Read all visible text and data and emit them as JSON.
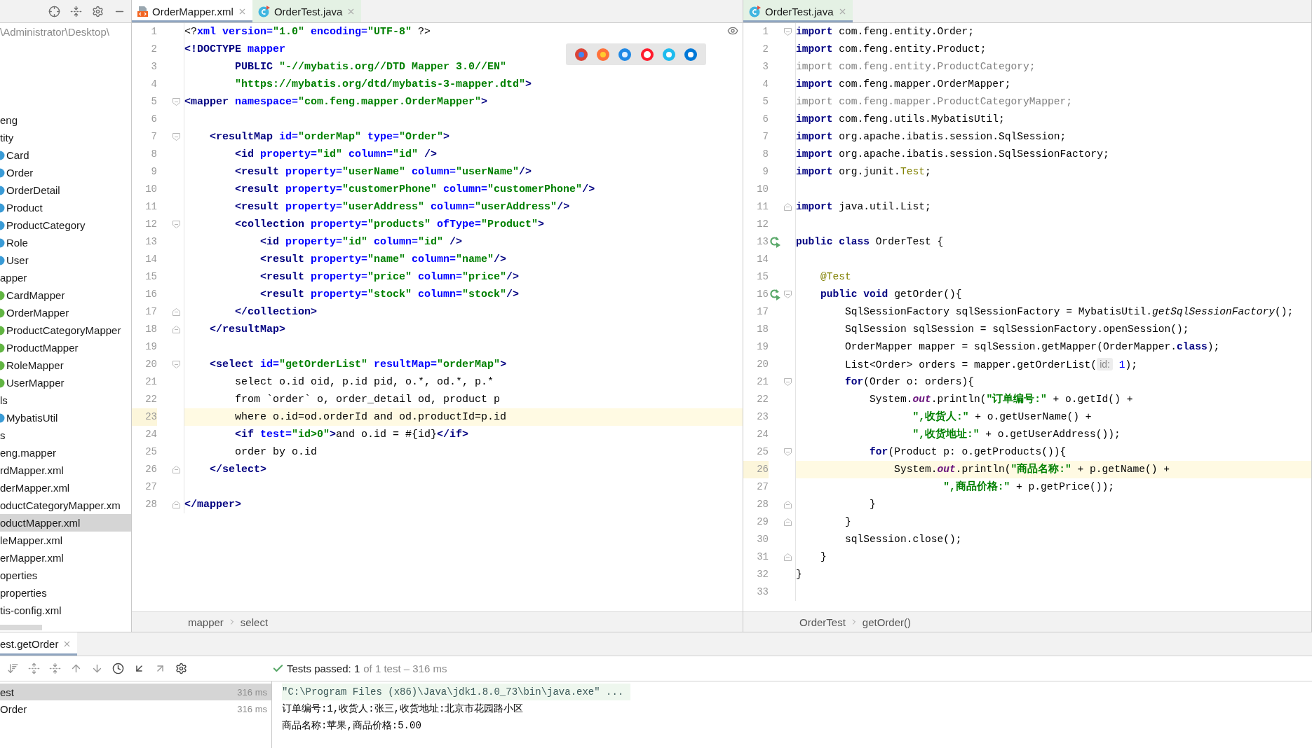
{
  "project_panel": {
    "path": "\\Administrator\\Desktop\\",
    "tree": [
      {
        "label": "eng",
        "selected": false,
        "children": [
          {
            "label": "tity",
            "selected": false,
            "children": [
              {
                "label": "Card",
                "kind": "class",
                "selected": false
              },
              {
                "label": "Order",
                "kind": "class",
                "selected": false
              },
              {
                "label": "OrderDetail",
                "kind": "class",
                "selected": false
              },
              {
                "label": "Product",
                "kind": "class",
                "selected": false
              },
              {
                "label": "ProductCategory",
                "kind": "class",
                "selected": false
              },
              {
                "label": "Role",
                "kind": "class",
                "selected": false
              },
              {
                "label": "User",
                "kind": "class",
                "selected": false
              }
            ]
          },
          {
            "label": "apper",
            "selected": false,
            "children": [
              {
                "label": "CardMapper",
                "kind": "interface",
                "selected": false
              },
              {
                "label": "OrderMapper",
                "kind": "interface",
                "selected": false
              },
              {
                "label": "ProductCategoryMapper",
                "kind": "interface",
                "selected": false
              },
              {
                "label": "ProductMapper",
                "kind": "interface",
                "selected": false
              },
              {
                "label": "RoleMapper",
                "kind": "interface",
                "selected": false
              },
              {
                "label": "UserMapper",
                "kind": "interface",
                "selected": false
              }
            ]
          },
          {
            "label": "ls",
            "selected": false,
            "children": [
              {
                "label": "MybatisUtil",
                "kind": "class",
                "selected": false
              }
            ]
          }
        ]
      },
      {
        "label": "s",
        "selected": false,
        "children": [
          {
            "label": "eng.mapper",
            "selected": false,
            "children": [
              {
                "label": "rdMapper.xml",
                "selected": false
              },
              {
                "label": "derMapper.xml",
                "selected": false
              },
              {
                "label": "oductCategoryMapper.xm",
                "selected": false
              },
              {
                "label": "oductMapper.xml",
                "selected": true
              },
              {
                "label": "leMapper.xml",
                "selected": false
              },
              {
                "label": "erMapper.xml",
                "selected": false
              }
            ]
          },
          {
            "label": "operties",
            "selected": false
          },
          {
            "label": "properties",
            "selected": false
          },
          {
            "label": "tis-config.xml",
            "selected": false
          }
        ]
      }
    ]
  },
  "editors": [
    {
      "tabs": [
        {
          "label": "OrderMapper.xml",
          "kind": "xml",
          "selected": true
        },
        {
          "label": "OrderTest.java",
          "kind": "test",
          "selected": false
        }
      ],
      "lines": [
        {
          "number": "1",
          "current": false,
          "tokens": [
            {
              "kind": "p",
              "text": "<?"
            },
            {
              "kind": "a",
              "text": "xml version="
            },
            {
              "kind": "s",
              "text": "\"1.0\""
            },
            {
              "kind": "a",
              "text": " encoding="
            },
            {
              "kind": "s",
              "text": "\"UTF-8\""
            },
            {
              "kind": "p",
              "text": " ?>"
            }
          ]
        },
        {
          "number": "2",
          "current": false,
          "tokens": [
            {
              "kind": "t",
              "text": "<!DOCTYPE "
            },
            {
              "kind": "a",
              "text": "mapper"
            }
          ]
        },
        {
          "number": "3",
          "current": false,
          "tokens": [
            {
              "kind": "t",
              "text": "        PUBLIC "
            },
            {
              "kind": "s",
              "text": "\"-//mybatis.org//DTD Mapper 3.0//EN\""
            }
          ]
        },
        {
          "number": "4",
          "current": false,
          "tokens": [
            {
              "kind": "s",
              "text": "        \"https://mybatis.org/dtd/mybatis-3-mapper.dtd\""
            },
            {
              "kind": "t",
              "text": ">"
            }
          ]
        },
        {
          "number": "5",
          "current": false,
          "kind": "fold",
          "tokens": [
            {
              "kind": "t",
              "text": "<mapper "
            },
            {
              "kind": "a",
              "text": "namespace="
            },
            {
              "kind": "s",
              "text": "\"com.feng.mapper.OrderMapper\""
            },
            {
              "kind": "t",
              "text": ">"
            }
          ]
        },
        {
          "number": "6",
          "current": false
        },
        {
          "number": "7",
          "current": false,
          "kind": "fold",
          "tokens": [
            {
              "kind": "t",
              "text": "    <resultMap "
            },
            {
              "kind": "a",
              "text": "id="
            },
            {
              "kind": "s",
              "text": "\"orderMap\""
            },
            {
              "kind": "a",
              "text": " type="
            },
            {
              "kind": "s",
              "text": "\"Order\""
            },
            {
              "kind": "t",
              "text": ">"
            }
          ]
        },
        {
          "number": "8",
          "current": false,
          "tokens": [
            {
              "kind": "t",
              "text": "        <id "
            },
            {
              "kind": "a",
              "text": "property="
            },
            {
              "kind": "s",
              "text": "\"id\""
            },
            {
              "kind": "a",
              "text": " column="
            },
            {
              "kind": "s",
              "text": "\"id\""
            },
            {
              "kind": "t",
              "text": " />"
            }
          ]
        },
        {
          "number": "9",
          "current": false,
          "tokens": [
            {
              "kind": "t",
              "text": "        <result "
            },
            {
              "kind": "a",
              "text": "property="
            },
            {
              "kind": "s",
              "text": "\"userName\""
            },
            {
              "kind": "a",
              "text": " column="
            },
            {
              "kind": "s",
              "text": "\"userName\""
            },
            {
              "kind": "t",
              "text": "/>"
            }
          ]
        },
        {
          "number": "10",
          "current": false,
          "tokens": [
            {
              "kind": "t",
              "text": "        <result "
            },
            {
              "kind": "a",
              "text": "property="
            },
            {
              "kind": "s",
              "text": "\"customerPhone\""
            },
            {
              "kind": "a",
              "text": " column="
            },
            {
              "kind": "s",
              "text": "\"customerPhone\""
            },
            {
              "kind": "t",
              "text": "/>"
            }
          ]
        },
        {
          "number": "11",
          "current": false,
          "tokens": [
            {
              "kind": "t",
              "text": "        <result "
            },
            {
              "kind": "a",
              "text": "property="
            },
            {
              "kind": "s",
              "text": "\"userAddress\""
            },
            {
              "kind": "a",
              "text": " column="
            },
            {
              "kind": "s",
              "text": "\"userAddress\""
            },
            {
              "kind": "t",
              "text": "/>"
            }
          ]
        },
        {
          "number": "12",
          "current": false,
          "kind": "fold",
          "tokens": [
            {
              "kind": "t",
              "text": "        <collection "
            },
            {
              "kind": "a",
              "text": "property="
            },
            {
              "kind": "s",
              "text": "\"products\""
            },
            {
              "kind": "a",
              "text": " ofType="
            },
            {
              "kind": "s",
              "text": "\"Product\""
            },
            {
              "kind": "t",
              "text": ">"
            }
          ]
        },
        {
          "number": "13",
          "current": false,
          "tokens": [
            {
              "kind": "t",
              "text": "            <id "
            },
            {
              "kind": "a",
              "text": "property="
            },
            {
              "kind": "s",
              "text": "\"id\""
            },
            {
              "kind": "a",
              "text": " column="
            },
            {
              "kind": "s",
              "text": "\"id\""
            },
            {
              "kind": "t",
              "text": " />"
            }
          ]
        },
        {
          "number": "14",
          "current": false,
          "tokens": [
            {
              "kind": "t",
              "text": "            <result "
            },
            {
              "kind": "a",
              "text": "property="
            },
            {
              "kind": "s",
              "text": "\"name\""
            },
            {
              "kind": "a",
              "text": " column="
            },
            {
              "kind": "s",
              "text": "\"name\""
            },
            {
              "kind": "t",
              "text": "/>"
            }
          ]
        },
        {
          "number": "15",
          "current": false,
          "tokens": [
            {
              "kind": "t",
              "text": "            <result "
            },
            {
              "kind": "a",
              "text": "property="
            },
            {
              "kind": "s",
              "text": "\"price\""
            },
            {
              "kind": "a",
              "text": " column="
            },
            {
              "kind": "s",
              "text": "\"price\""
            },
            {
              "kind": "t",
              "text": "/>"
            }
          ]
        },
        {
          "number": "16",
          "current": false,
          "tokens": [
            {
              "kind": "t",
              "text": "            <result "
            },
            {
              "kind": "a",
              "text": "property="
            },
            {
              "kind": "s",
              "text": "\"stock\""
            },
            {
              "kind": "a",
              "text": " column="
            },
            {
              "kind": "s",
              "text": "\"stock\""
            },
            {
              "kind": "t",
              "text": "/>"
            }
          ]
        },
        {
          "number": "17",
          "current": false,
          "kind": "end",
          "tokens": [
            {
              "kind": "t",
              "text": "        </collection>"
            }
          ]
        },
        {
          "number": "18",
          "current": false,
          "kind": "end",
          "tokens": [
            {
              "kind": "t",
              "text": "    </resultMap>"
            }
          ]
        },
        {
          "number": "19",
          "current": false
        },
        {
          "number": "20",
          "current": false,
          "kind": "fold",
          "tokens": [
            {
              "kind": "t",
              "text": "    <select "
            },
            {
              "kind": "a",
              "text": "id="
            },
            {
              "kind": "s",
              "text": "\"getOrderList\""
            },
            {
              "kind": "a",
              "text": " resultMap="
            },
            {
              "kind": "s",
              "text": "\"orderMap\""
            },
            {
              "kind": "t",
              "text": ">"
            }
          ]
        },
        {
          "number": "21",
          "current": false,
          "tokens": [
            {
              "kind": "p",
              "text": "        select o.id oid, p.id pid, o.*, od.*, p.*"
            }
          ]
        },
        {
          "number": "22",
          "current": false,
          "tokens": [
            {
              "kind": "p",
              "text": "        from `order` o, order_detail od, product p"
            }
          ]
        },
        {
          "number": "23",
          "current": true,
          "tokens": [
            {
              "kind": "p",
              "text": "        where o.id=od.orderId and od.productId=p.id"
            }
          ]
        },
        {
          "number": "24",
          "current": false,
          "tokens": [
            {
              "kind": "t",
              "text": "        <if "
            },
            {
              "kind": "a",
              "text": "test="
            },
            {
              "kind": "s",
              "text": "\"id>0\""
            },
            {
              "kind": "t",
              "text": ">"
            },
            {
              "kind": "p",
              "text": "and o.id = #{id}"
            },
            {
              "kind": "t",
              "text": "</if>"
            }
          ]
        },
        {
          "number": "25",
          "current": false,
          "tokens": [
            {
              "kind": "p",
              "text": "        order by o.id"
            }
          ]
        },
        {
          "number": "26",
          "current": false,
          "kind": "end",
          "tokens": [
            {
              "kind": "t",
              "text": "    </select>"
            }
          ]
        },
        {
          "number": "27",
          "current": false
        },
        {
          "number": "28",
          "current": false,
          "kind": "end",
          "tokens": [
            {
              "kind": "t",
              "text": "</mapper>"
            }
          ]
        }
      ],
      "breadcrumbs": [
        "mapper",
        "select"
      ]
    },
    {
      "tabs": [
        {
          "label": "OrderTest.java",
          "kind": "test",
          "selected": true
        }
      ],
      "lines": [
        {
          "number": "1",
          "current": false,
          "kind": "fold",
          "tokens": [
            {
              "kind": "k",
              "text": "import"
            },
            {
              "kind": "p",
              "text": " com.feng.entity.Order;"
            }
          ]
        },
        {
          "number": "2",
          "current": false,
          "tokens": [
            {
              "kind": "k",
              "text": "import"
            },
            {
              "kind": "p",
              "text": " com.feng.entity.Product;"
            }
          ]
        },
        {
          "number": "3",
          "current": false,
          "tokens": [
            {
              "kind": "d",
              "text": "import com.feng.entity.ProductCategory;"
            }
          ]
        },
        {
          "number": "4",
          "current": false,
          "tokens": [
            {
              "kind": "k",
              "text": "import"
            },
            {
              "kind": "p",
              "text": " com.feng.mapper.OrderMapper;"
            }
          ]
        },
        {
          "number": "5",
          "current": false,
          "tokens": [
            {
              "kind": "d",
              "text": "import com.feng.mapper.ProductCategoryMapper;"
            }
          ]
        },
        {
          "number": "6",
          "current": false,
          "tokens": [
            {
              "kind": "k",
              "text": "import"
            },
            {
              "kind": "p",
              "text": " com.feng.utils.MybatisUtil;"
            }
          ]
        },
        {
          "number": "7",
          "current": false,
          "tokens": [
            {
              "kind": "k",
              "text": "import"
            },
            {
              "kind": "p",
              "text": " org.apache.ibatis.session.SqlSession;"
            }
          ]
        },
        {
          "number": "8",
          "current": false,
          "tokens": [
            {
              "kind": "k",
              "text": "import"
            },
            {
              "kind": "p",
              "text": " org.apache.ibatis.session.SqlSessionFactory;"
            }
          ]
        },
        {
          "number": "9",
          "current": false,
          "tokens": [
            {
              "kind": "k",
              "text": "import"
            },
            {
              "kind": "p",
              "text": " org.junit."
            },
            {
              "kind": "n",
              "text": "Test"
            },
            {
              "kind": "p",
              "text": ";"
            }
          ]
        },
        {
          "number": "10",
          "current": false
        },
        {
          "number": "11",
          "current": false,
          "kind": "end",
          "tokens": [
            {
              "kind": "k",
              "text": "import"
            },
            {
              "kind": "p",
              "text": " java.util.List;"
            }
          ]
        },
        {
          "number": "12",
          "current": false
        },
        {
          "number": "13",
          "current": false,
          "kind": "run",
          "tokens": [
            {
              "kind": "k",
              "text": "public class"
            },
            {
              "kind": "p",
              "text": " OrderTest {"
            }
          ]
        },
        {
          "number": "14",
          "current": false
        },
        {
          "number": "15",
          "current": false,
          "tokens": [
            {
              "kind": "n",
              "text": "    @Test"
            }
          ]
        },
        {
          "number": "16",
          "current": false,
          "kind": "runfold",
          "tokens": [
            {
              "kind": "k",
              "text": "    public void"
            },
            {
              "kind": "p",
              "text": " getOrder(){"
            }
          ]
        },
        {
          "number": "17",
          "current": false,
          "tokens": [
            {
              "kind": "p",
              "text": "        SqlSessionFactory sqlSessionFactory = MybatisUtil."
            },
            {
              "kind": "m",
              "text": "getSqlSessionFactory"
            },
            {
              "kind": "p",
              "text": "();"
            }
          ]
        },
        {
          "number": "18",
          "current": false,
          "tokens": [
            {
              "kind": "p",
              "text": "        SqlSession sqlSession = sqlSessionFactory.openSession();"
            }
          ]
        },
        {
          "number": "19",
          "current": false,
          "tokens": [
            {
              "kind": "p",
              "text": "        OrderMapper mapper = sqlSession.getMapper(OrderMapper."
            },
            {
              "kind": "k",
              "text": "class"
            },
            {
              "kind": "p",
              "text": ");"
            }
          ]
        },
        {
          "number": "20",
          "current": false,
          "tokens": [
            {
              "kind": "p",
              "text": "        List<Order> orders = mapper.getOrderList("
            },
            {
              "kind": "h",
              "text": "id:"
            },
            {
              "kind": "u",
              "text": " 1"
            },
            {
              "kind": "p",
              "text": ");"
            }
          ]
        },
        {
          "number": "21",
          "current": false,
          "kind": "fold",
          "tokens": [
            {
              "kind": "k",
              "text": "        for"
            },
            {
              "kind": "p",
              "text": "(Order o: orders){"
            }
          ]
        },
        {
          "number": "22",
          "current": false,
          "tokens": [
            {
              "kind": "p",
              "text": "            System."
            },
            {
              "kind": "f",
              "text": "out"
            },
            {
              "kind": "p",
              "text": ".println("
            },
            {
              "kind": "s",
              "text": "\"订单编号:\""
            },
            {
              "kind": "p",
              "text": " + o.getId() +"
            }
          ]
        },
        {
          "number": "23",
          "current": false,
          "tokens": [
            {
              "kind": "s",
              "text": "                   \",收货人:\""
            },
            {
              "kind": "p",
              "text": " + o.getUserName() +"
            }
          ]
        },
        {
          "number": "24",
          "current": false,
          "tokens": [
            {
              "kind": "s",
              "text": "                   \",收货地址:\""
            },
            {
              "kind": "p",
              "text": " + o.getUserAddress());"
            }
          ]
        },
        {
          "number": "25",
          "current": false,
          "kind": "fold",
          "tokens": [
            {
              "kind": "k",
              "text": "            for"
            },
            {
              "kind": "p",
              "text": "(Product p: o.getProducts()){"
            }
          ]
        },
        {
          "number": "26",
          "current": true,
          "tokens": [
            {
              "kind": "p",
              "text": "                System."
            },
            {
              "kind": "f",
              "text": "out"
            },
            {
              "kind": "p",
              "text": ".println("
            },
            {
              "kind": "s",
              "text": "\"商品名称:\""
            },
            {
              "kind": "p",
              "text": " + p.getName() +"
            }
          ]
        },
        {
          "number": "27",
          "current": false,
          "tokens": [
            {
              "kind": "s",
              "text": "                        \",商品价格:\""
            },
            {
              "kind": "p",
              "text": " + p.getPrice());"
            }
          ]
        },
        {
          "number": "28",
          "current": false,
          "kind": "end",
          "tokens": [
            {
              "kind": "p",
              "text": "            }"
            }
          ]
        },
        {
          "number": "29",
          "current": false,
          "kind": "end",
          "tokens": [
            {
              "kind": "p",
              "text": "        }"
            }
          ]
        },
        {
          "number": "30",
          "current": false,
          "tokens": [
            {
              "kind": "p",
              "text": "        sqlSession.close();"
            }
          ]
        },
        {
          "number": "31",
          "current": false,
          "kind": "end",
          "tokens": [
            {
              "kind": "p",
              "text": "    }"
            }
          ]
        },
        {
          "number": "32",
          "current": false,
          "tokens": [
            {
              "kind": "p",
              "text": "}"
            }
          ]
        },
        {
          "number": "33",
          "current": false
        }
      ],
      "breadcrumbs": [
        "OrderTest",
        "getOrder()"
      ]
    }
  ],
  "run_panel": {
    "tab": "est.getOrder",
    "status": "Tests passed: 1",
    "status_detail": "of 1 test – 316 ms",
    "tests": [
      {
        "label": "est",
        "time": "316 ms",
        "selected": true,
        "children": [
          {
            "label": "Order",
            "time": "316 ms",
            "selected": false
          }
        ]
      }
    ],
    "console": [
      {
        "kind": "command",
        "text": "\"C:\\Program Files (x86)\\Java\\jdk1.8.0_73\\bin\\java.exe\" ..."
      },
      {
        "kind": "output",
        "text": "订单编号:1,收货人:张三,收货地址:北京市花园路小区"
      },
      {
        "kind": "output",
        "text": "商品名称:苹果,商品价格:5.00"
      }
    ]
  }
}
